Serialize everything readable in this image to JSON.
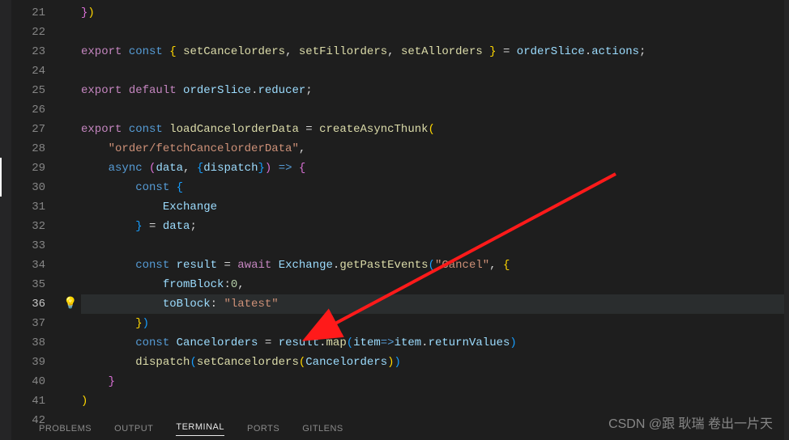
{
  "lines": {
    "start": 21,
    "end": 42,
    "active": 36
  },
  "panel": {
    "tabs": [
      "PROBLEMS",
      "OUTPUT",
      "TERMINAL",
      "PORTS",
      "GITLENS"
    ],
    "active": "TERMINAL"
  },
  "watermark": "CSDN @跟 耿瑞 卷出一片天",
  "code": {
    "l21": {
      "text": "})"
    },
    "l22": {
      "text": ""
    },
    "l23": {
      "kw_export": "export",
      "kw_const": "const",
      "fn1": "setCancelorders",
      "fn2": "setFillorders",
      "fn3": "setAllorders",
      "obj": "orderSlice",
      "prop": "actions"
    },
    "l24": {
      "text": ""
    },
    "l25": {
      "kw_export": "export",
      "kw_default": "default",
      "obj": "orderSlice",
      "prop": "reducer"
    },
    "l26": {
      "text": ""
    },
    "l27": {
      "kw_export": "export",
      "kw_const": "const",
      "name": "loadCancelorderData",
      "fn": "createAsyncThunk"
    },
    "l28": {
      "str": "\"order/fetchCancelorderData\""
    },
    "l29": {
      "kw_async": "async",
      "p1": "data",
      "p2": "dispatch"
    },
    "l30": {
      "kw_const": "const"
    },
    "l31": {
      "name": "Exchange"
    },
    "l32": {
      "name": "data"
    },
    "l33": {
      "text": ""
    },
    "l34": {
      "kw_const": "const",
      "name": "result",
      "kw_await": "await",
      "obj": "Exchange",
      "fn": "getPastEvents",
      "str": "\"Cancel\""
    },
    "l35": {
      "prop": "fromBlock",
      "val": "0"
    },
    "l36": {
      "prop": "toBlock",
      "str": "\"latest\""
    },
    "l37": {
      "text": "})"
    },
    "l38": {
      "kw_const": "const",
      "name": "Cancelorders",
      "obj": "result",
      "fn": "map",
      "p": "item",
      "obj2": "item",
      "prop": "returnValues"
    },
    "l39": {
      "fn1": "dispatch",
      "fn2": "setCancelorders",
      "arg": "Cancelorders"
    },
    "l40": {
      "text": "}"
    },
    "l41": {
      "text": ")"
    },
    "l42": {
      "text": ""
    }
  }
}
